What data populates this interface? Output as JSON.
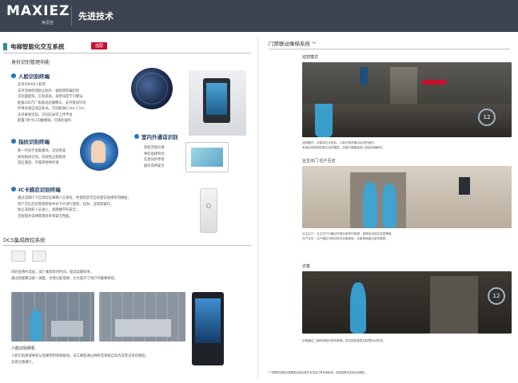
{
  "header": {
    "logo": "MAXIEZ",
    "logo_sub": "美嘉智",
    "title": "先进技术"
  },
  "left": {
    "section_title": "电梯智能化交互系统",
    "badge": "选配",
    "subsection": "身份识别管理功能",
    "face": {
      "title": "人脸识别终端",
      "lines": [
        "支持50000人脸库",
        "支持活体检测防止照片、视频等欺骗识别",
        "识别速度快，识别率高，采用深度学习算法",
        "配备200万广角宽动态摄像头，支持夜间识别",
        "环境光线自适应补光，识别距离0.3m-1.5m",
        "支持离线识别，识别记录可上传平台",
        "配置7英寸LCD触摸屏，可视化操作"
      ]
    },
    "finger": {
      "title": "指纹识别终端",
      "lines": [
        "新一代光学采集模块，识别率高",
        "防伪指纹识别，有效防止假指纹",
        "适应潮湿、干燥等各种环境"
      ]
    },
    "intercom": {
      "title": "室内外通话识别",
      "lines": [
        "轻松可视对讲",
        "呼叫电梯到达",
        "信息同步更新",
        "操作简单安全"
      ]
    },
    "ic": {
      "title": "IC卡感应识别终端",
      "lines": [
        "通过读取IC卡信息验证乘梯人员身份，经授权后可自动登记电梯目的楼层，",
        "用户可在后台管理系统中对卡片进行授权、挂失、注销等操作，",
        "防止非授权人员进入，保障楼宇的安全，",
        "全面提升电梯管理效率和安全性能。"
      ]
    },
    "dcs": {
      "title": "DCS集成群控系统",
      "lines": [
        "目的层预约选层，减少乘客等待时间，提高运输效率，",
        "通过智能算法统一调度，合理分配电梯，大大提升了用户的乘梯体验。"
      ]
    },
    "caption_title": "人脸识别闸机",
    "caption_lines": [
      "人脸识别通道闸机与电梯控制系统联动，员工刷脸通过闸机后系统自动为其登记目的楼层，",
      "实现无感通行。"
    ]
  },
  "right": {
    "section_title": "门禁联动乘梯系统",
    "sec_mark": "TM",
    "scene1": {
      "label": "迎宾模式",
      "lines": [
        "迎宾模式：访客到达大堂后，人脸识别终端自动识别身份，",
        "系统自动呼梯并登记目的楼层，访客只需直接进入指定电梯即可。"
      ]
    },
    "scene2": {
      "label": "业主出门 住户互访",
      "lines": [
        "业主出门：业主在户内通过可视对讲呼叫电梯，电梯自动到达本层等候。",
        "住户互访：住户通过可视对讲为访客授权，访客乘梯直达被访楼层。"
      ]
    },
    "scene3": {
      "label": "访客",
      "lines": [
        "访客通过二维码或临时密码乘梯，到达指定楼层后权限自动失效。"
      ]
    },
    "footnote": "*门禁联动乘梯功能需配合相应楼宇对讲及门禁系统使用，具体配置请咨询当地销售。",
    "display_number": "12"
  },
  "colors": {
    "header": "#3b4450",
    "accent": "#2e8f8a",
    "badge": "#c8102e",
    "feature_dot": "#2376b8",
    "silhouette": "#3aa6d8"
  }
}
